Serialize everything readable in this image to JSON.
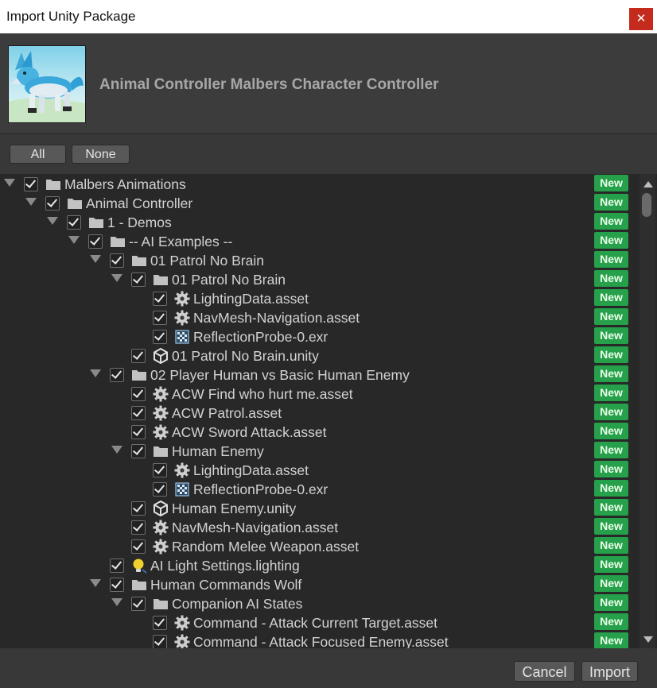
{
  "window": {
    "title": "Import Unity Package",
    "close_label": "✕"
  },
  "package": {
    "title": "Animal Controller Malbers Character Controller"
  },
  "selection": {
    "all_label": "All",
    "none_label": "None"
  },
  "tree": [
    {
      "label": "Malbers Animations",
      "depth": 0,
      "type": "folder",
      "expanded": true,
      "checked": true,
      "badge": "New"
    },
    {
      "label": "Animal Controller",
      "depth": 1,
      "type": "folder",
      "expanded": true,
      "checked": true,
      "badge": "New"
    },
    {
      "label": "1 - Demos",
      "depth": 2,
      "type": "folder",
      "expanded": true,
      "checked": true,
      "badge": "New"
    },
    {
      "label": "-- AI Examples --",
      "depth": 3,
      "type": "folder",
      "expanded": true,
      "checked": true,
      "badge": "New"
    },
    {
      "label": "01 Patrol No Brain",
      "depth": 4,
      "type": "folder",
      "expanded": true,
      "checked": true,
      "badge": "New"
    },
    {
      "label": "01 Patrol No Brain",
      "depth": 5,
      "type": "folder",
      "expanded": true,
      "checked": true,
      "badge": "New"
    },
    {
      "label": "LightingData.asset",
      "depth": 6,
      "type": "gear",
      "checked": true,
      "badge": "New"
    },
    {
      "label": "NavMesh-Navigation.asset",
      "depth": 6,
      "type": "gear",
      "checked": true,
      "badge": "New"
    },
    {
      "label": "ReflectionProbe-0.exr",
      "depth": 6,
      "type": "texture",
      "checked": true,
      "badge": "New"
    },
    {
      "label": "01 Patrol No Brain.unity",
      "depth": 5,
      "type": "unity",
      "checked": true,
      "badge": "New"
    },
    {
      "label": "02 Player Human vs Basic Human Enemy",
      "depth": 4,
      "type": "folder",
      "expanded": true,
      "checked": true,
      "badge": "New"
    },
    {
      "label": "ACW Find who hurt me.asset",
      "depth": 5,
      "type": "gear",
      "checked": true,
      "badge": "New"
    },
    {
      "label": "ACW Patrol.asset",
      "depth": 5,
      "type": "gear",
      "checked": true,
      "badge": "New"
    },
    {
      "label": "ACW Sword Attack.asset",
      "depth": 5,
      "type": "gear",
      "checked": true,
      "badge": "New"
    },
    {
      "label": "Human Enemy",
      "depth": 5,
      "type": "folder",
      "expanded": true,
      "checked": true,
      "badge": "New"
    },
    {
      "label": "LightingData.asset",
      "depth": 6,
      "type": "gear",
      "checked": true,
      "badge": "New"
    },
    {
      "label": "ReflectionProbe-0.exr",
      "depth": 6,
      "type": "texture",
      "checked": true,
      "badge": "New"
    },
    {
      "label": "Human Enemy.unity",
      "depth": 5,
      "type": "unity",
      "checked": true,
      "badge": "New"
    },
    {
      "label": "NavMesh-Navigation.asset",
      "depth": 5,
      "type": "gear",
      "checked": true,
      "badge": "New"
    },
    {
      "label": "Random Melee Weapon.asset",
      "depth": 5,
      "type": "gear",
      "checked": true,
      "badge": "New"
    },
    {
      "label": "AI Light Settings.lighting",
      "depth": 4,
      "type": "light",
      "checked": true,
      "badge": "New"
    },
    {
      "label": "Human Commands Wolf",
      "depth": 4,
      "type": "folder",
      "expanded": true,
      "checked": true,
      "badge": "New"
    },
    {
      "label": "Companion AI States",
      "depth": 5,
      "type": "folder",
      "expanded": true,
      "checked": true,
      "badge": "New"
    },
    {
      "label": "Command - Attack Current Target.asset",
      "depth": 6,
      "type": "gear",
      "checked": true,
      "badge": "New"
    },
    {
      "label": "Command - Attack Focused Enemy.asset",
      "depth": 6,
      "type": "gear",
      "checked": true,
      "badge": "New"
    }
  ],
  "footer": {
    "cancel_label": "Cancel",
    "import_label": "Import"
  },
  "colors": {
    "badge": "#26a04a",
    "close_button": "#c42b1c"
  }
}
